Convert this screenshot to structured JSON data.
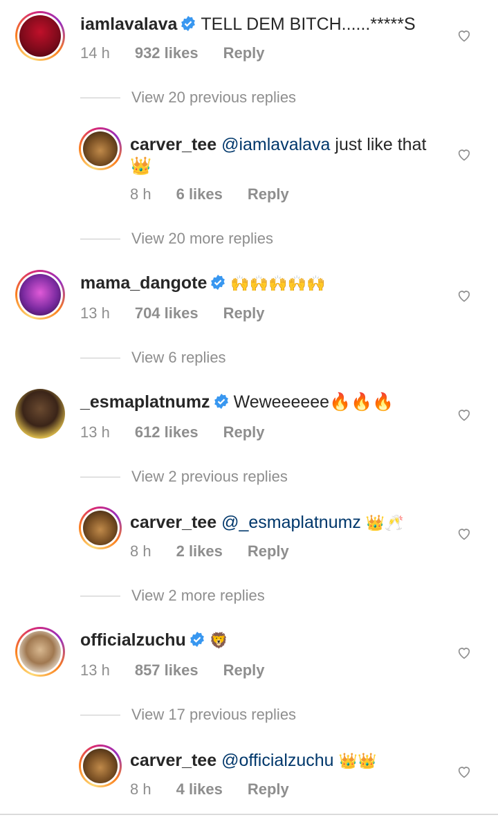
{
  "comments": [
    {
      "username": "iamlavalava",
      "verified": true,
      "text": "TELL DEM BITCH......*****S",
      "time": "14 h",
      "likes": "932 likes",
      "reply": "Reply",
      "view_replies": "View 20 previous replies",
      "replies": [
        {
          "username": "carver_tee",
          "mention": "@iamlavalava",
          "text": " just like that 👑",
          "time": "8 h",
          "likes": "6 likes",
          "reply": "Reply"
        }
      ],
      "view_more": "View 20 more replies"
    },
    {
      "username": "mama_dangote",
      "verified": true,
      "text": "🙌🙌🙌🙌🙌",
      "time": "13 h",
      "likes": "704 likes",
      "reply": "Reply",
      "view_replies": "View 6 replies"
    },
    {
      "username": "_esmaplatnumz",
      "verified": true,
      "text": "Weweeeeee🔥🔥🔥",
      "time": "13 h",
      "likes": "612 likes",
      "reply": "Reply",
      "view_replies": "View 2 previous replies",
      "replies": [
        {
          "username": "carver_tee",
          "mention": "@_esmaplatnumz",
          "text": " 👑🥂",
          "time": "8 h",
          "likes": "2 likes",
          "reply": "Reply"
        }
      ],
      "view_more": "View 2 more replies"
    },
    {
      "username": "officialzuchu",
      "verified": true,
      "text": "🦁",
      "time": "13 h",
      "likes": "857 likes",
      "reply": "Reply",
      "view_replies": "View 17 previous replies",
      "replies": [
        {
          "username": "carver_tee",
          "mention": "@officialzuchu",
          "text": " 👑👑",
          "time": "8 h",
          "likes": "4 likes",
          "reply": "Reply"
        }
      ]
    }
  ],
  "icons": {
    "verified": "verified-badge-icon",
    "heart": "heart-outline-icon"
  },
  "colors": {
    "text": "#262626",
    "secondary": "#8e8e8e",
    "mention": "#00376b",
    "verified": "#3897f0"
  }
}
